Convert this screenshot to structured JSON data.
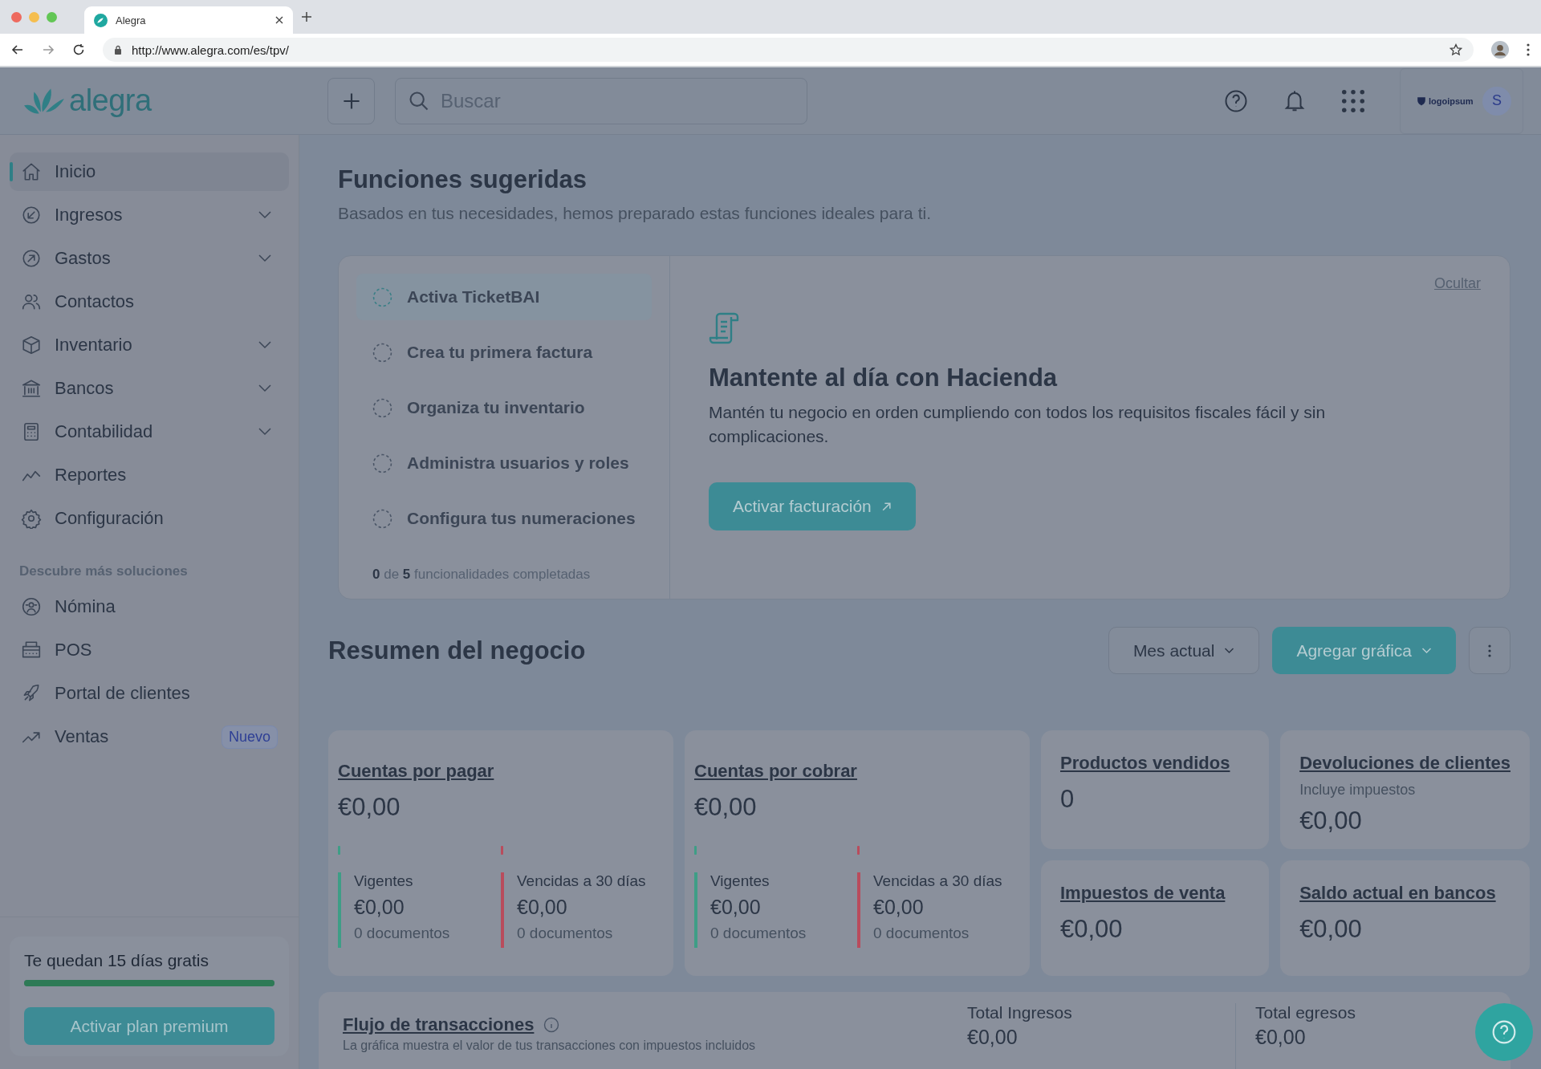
{
  "browser": {
    "tab_title": "Alegra",
    "url": "http://www.alegra.com/es/tpv/"
  },
  "header": {
    "logo": "alegra",
    "search": {
      "placeholder": "Buscar"
    },
    "company_logo": "logoipsum",
    "avatar": "S"
  },
  "sidebar": {
    "items": [
      {
        "label": "Inicio",
        "selected": true,
        "expandable": false
      },
      {
        "label": "Ingresos",
        "selected": false,
        "expandable": true
      },
      {
        "label": "Gastos",
        "selected": false,
        "expandable": true
      },
      {
        "label": "Contactos",
        "selected": false,
        "expandable": false
      },
      {
        "label": "Inventario",
        "selected": false,
        "expandable": true
      },
      {
        "label": "Bancos",
        "selected": false,
        "expandable": true
      },
      {
        "label": "Contabilidad",
        "selected": false,
        "expandable": true
      },
      {
        "label": "Reportes",
        "selected": false,
        "expandable": false
      },
      {
        "label": "Configuración",
        "selected": false,
        "expandable": false
      }
    ],
    "section_title": "Descubre más soluciones",
    "solutions": [
      {
        "label": "Nómina"
      },
      {
        "label": "POS"
      },
      {
        "label": "Portal de clientes"
      },
      {
        "label": "Ventas",
        "badge": "Nuevo"
      }
    ],
    "trial": {
      "text": "Te quedan 15 días gratis",
      "level": 1,
      "button": "Activar plan premium"
    }
  },
  "suggested": {
    "title": "Funciones sugeridas",
    "subtitle": "Basados en tus necesidades, hemos preparado estas funciones ideales para ti.",
    "tasks": [
      {
        "label": "Activa TicketBAI",
        "selected": true
      },
      {
        "label": "Crea tu primera factura",
        "selected": false
      },
      {
        "label": "Organiza tu inventario",
        "selected": false
      },
      {
        "label": "Administra usuarios y roles",
        "selected": false
      },
      {
        "label": "Configura tus numeraciones",
        "selected": false
      }
    ],
    "progress": "**0** de **5** funcionalidades completadas",
    "hide_link": "Ocultar",
    "detail": {
      "title": "Mantente al día con Hacienda",
      "description": "Mantén tu negocio en orden cumpliendo con todos los requisitos fiscales fácil y sin complicaciones.",
      "button": "Activar facturación"
    }
  },
  "summary": {
    "title": "Resumen del negocio",
    "period_button": "Mes actual",
    "add_button": "Agregar gráfica",
    "cards": [
      {
        "title": "Cuentas por pagar",
        "amount": "€0,00",
        "segments": [
          {
            "label": "Vigentes",
            "amount": "€0,00",
            "count": "0 documentos",
            "color": "#3e9e86"
          },
          {
            "label": "Vencidas a 30 días",
            "amount": "€0,00",
            "count": "0 documentos",
            "color": "#b94c5c"
          }
        ]
      },
      {
        "title": "Cuentas por cobrar",
        "amount": "€0,00",
        "segments": [
          {
            "label": "Vigentes",
            "amount": "€0,00",
            "count": "0 documentos",
            "color": "#3e9e86"
          },
          {
            "label": "Vencidas a 30 días",
            "amount": "€0,00",
            "count": "0 documentos",
            "color": "#b94c5c"
          }
        ]
      }
    ],
    "small_cards": [
      {
        "title": "Productos vendidos",
        "value": "0"
      },
      {
        "title": "Devoluciones de clientes",
        "note": "Incluye impuestos",
        "value": "€0,00"
      },
      {
        "title": "Impuestos de venta",
        "value": "€0,00"
      },
      {
        "title": "Saldo actual en bancos",
        "value": "€0,00"
      }
    ]
  },
  "flow": {
    "title": "Flujo de transacciones",
    "subtitle": "La gráfica muestra el valor de tus transacciones con impuestos incluidos",
    "totals": [
      {
        "label": "Total Ingresos",
        "amount": "€0,00"
      },
      {
        "label": "Total egresos",
        "amount": "€0,00"
      }
    ]
  }
}
